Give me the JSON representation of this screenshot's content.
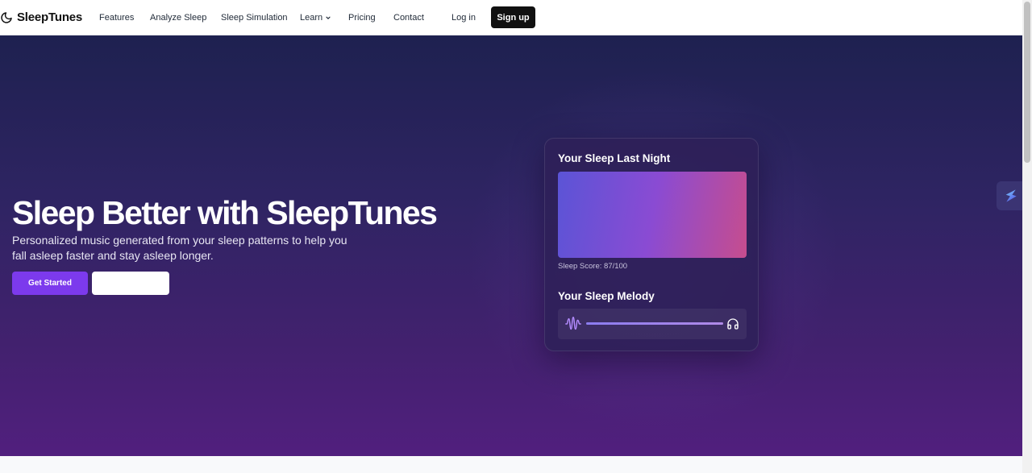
{
  "nav": {
    "brand": "SleepTunes",
    "links": {
      "features": "Features",
      "analyze": "Analyze Sleep",
      "simulation": "Sleep Simulation",
      "learn": "Learn",
      "pricing": "Pricing",
      "contact": "Contact"
    },
    "login": "Log in",
    "signup": "Sign up"
  },
  "hero": {
    "title": "Sleep Better with SleepTunes",
    "subtitle": "Personalized music generated from your sleep patterns to help you fall asleep faster and stay asleep longer.",
    "primary_cta": "Get Started",
    "secondary_cta": ""
  },
  "card": {
    "sleep_heading": "Your Sleep Last Night",
    "score_text": "Sleep Score: 87/100",
    "melody_heading": "Your Sleep Melody",
    "melody_progress": 1.0
  },
  "colors": {
    "accent": "#7c3aed",
    "hero_top": "#1e2150",
    "hero_bottom": "#511f7e",
    "sleep_gradient_start": "#5b54d6",
    "sleep_gradient_end": "#c64d8e"
  },
  "icons": {
    "brand": "moon-icon",
    "learn_dropdown": "chevron-down-icon",
    "waveform": "waveform-icon",
    "headphones": "headphones-icon",
    "floating": "lightning-widget-icon"
  }
}
